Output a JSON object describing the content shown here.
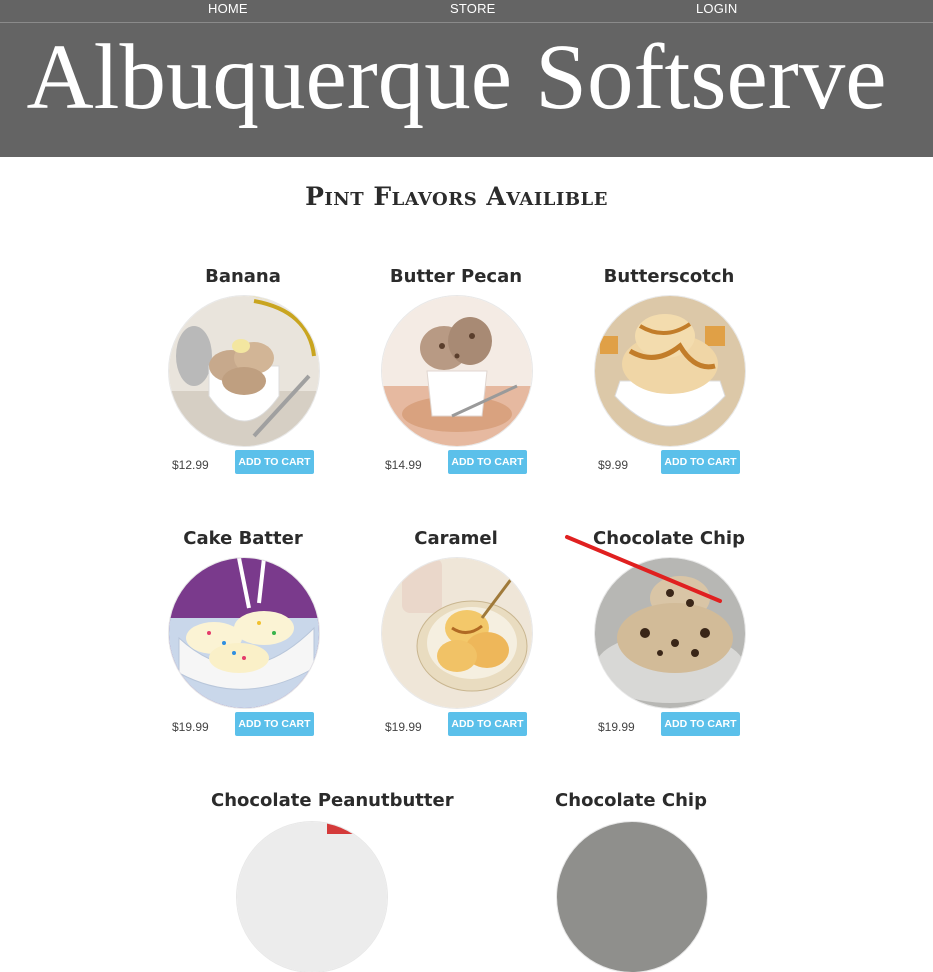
{
  "nav": {
    "home": "HOME",
    "store": "STORE",
    "login": "LOGIN"
  },
  "header": {
    "title": "Albuquerque Softserve"
  },
  "section": {
    "title": "Pint Flavors Availible"
  },
  "add_to_cart_label": "ADD TO CART",
  "products": [
    {
      "name": "Banana",
      "price": "$12.99"
    },
    {
      "name": "Butter Pecan",
      "price": "$14.99"
    },
    {
      "name": "Butterscotch",
      "price": "$9.99"
    },
    {
      "name": "Cake Batter",
      "price": "$19.99"
    },
    {
      "name": "Caramel",
      "price": "$19.99"
    },
    {
      "name": "Chocolate Chip",
      "price": "$19.99"
    },
    {
      "name": "Chocolate Peanutbutter"
    },
    {
      "name": "Chocolate Chip"
    }
  ],
  "colors": {
    "header_bg": "#646464",
    "button_bg": "#5bc0ea",
    "annotation_arrow": "#e02020"
  }
}
